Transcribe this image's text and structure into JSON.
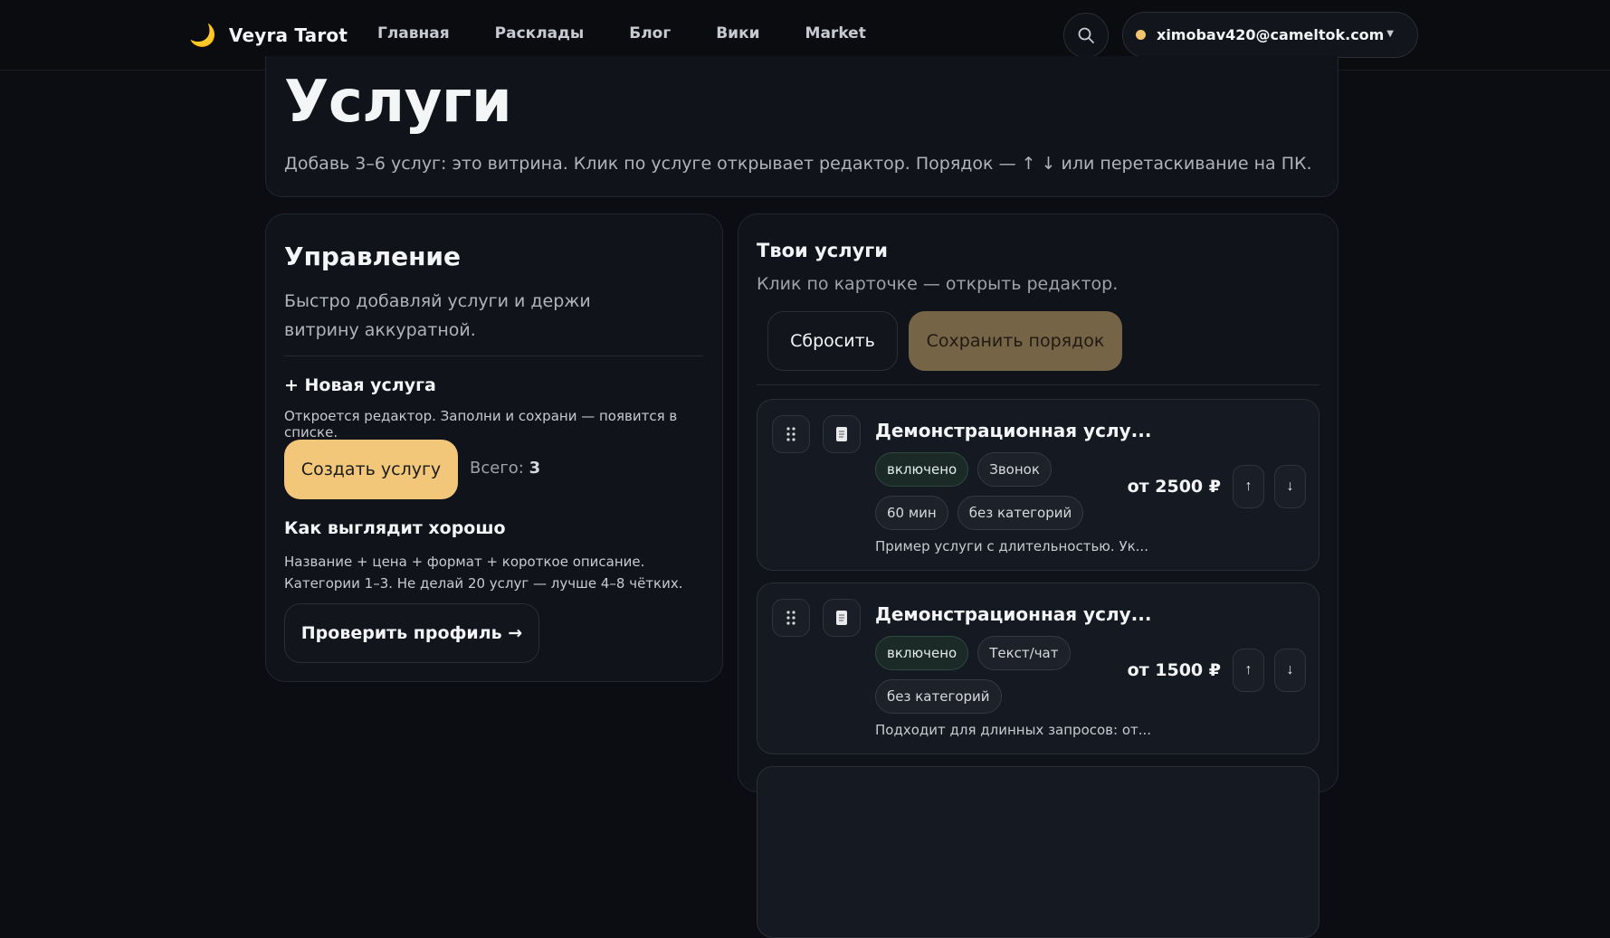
{
  "header": {
    "brand": "Veyra Tarot",
    "brand_icon": "moon-icon",
    "nav": [
      "Главная",
      "Расклады",
      "Блог",
      "Вики",
      "Market"
    ],
    "user_email": "ximobav420@cameltok.com",
    "accent_color": "#f2c46d"
  },
  "page": {
    "title": "Услуги",
    "subtitle": "Добавь 3–6 услуг: это витрина. Клик по услуге открывает редактор. Порядок — ↑ ↓ или перетаскивание на ПК."
  },
  "manage": {
    "title": "Управление",
    "lead": "Быстро добавляй услуги и держи витрину аккуратной.",
    "new_title": "+ Новая услуга",
    "new_desc": "Откроется редактор. Заполни и сохрани — появится в списке.",
    "create_label": "Создать услугу",
    "total_label": "Всего:",
    "total_value": "3",
    "good_title": "Как выглядит хорошо",
    "good_desc": "Название + цена + формат + короткое описание. Категории 1–3. Не делай 20 услуг — лучше 4–8 чётких.",
    "check_label": "Проверить профиль →"
  },
  "services": {
    "title": "Твои услуги",
    "hint": "Клик по карточке — открыть редактор.",
    "reset_label": "Сбросить",
    "save_label": "Сохранить порядок",
    "items": [
      {
        "name": "Демонстрационная услу...",
        "chips": [
          "включено",
          "Звонок",
          "60 мин",
          "без категорий"
        ],
        "price": "от 2500 ₽",
        "desc": "Пример услуги с длительностью. Ук..."
      },
      {
        "name": "Демонстрационная услу...",
        "chips": [
          "включено",
          "Текст/чат",
          "без категорий"
        ],
        "price": "от 1500 ₽",
        "desc": "Подходит для длинных запросов: от..."
      }
    ],
    "up_arrow": "↑",
    "down_arrow": "↓"
  }
}
